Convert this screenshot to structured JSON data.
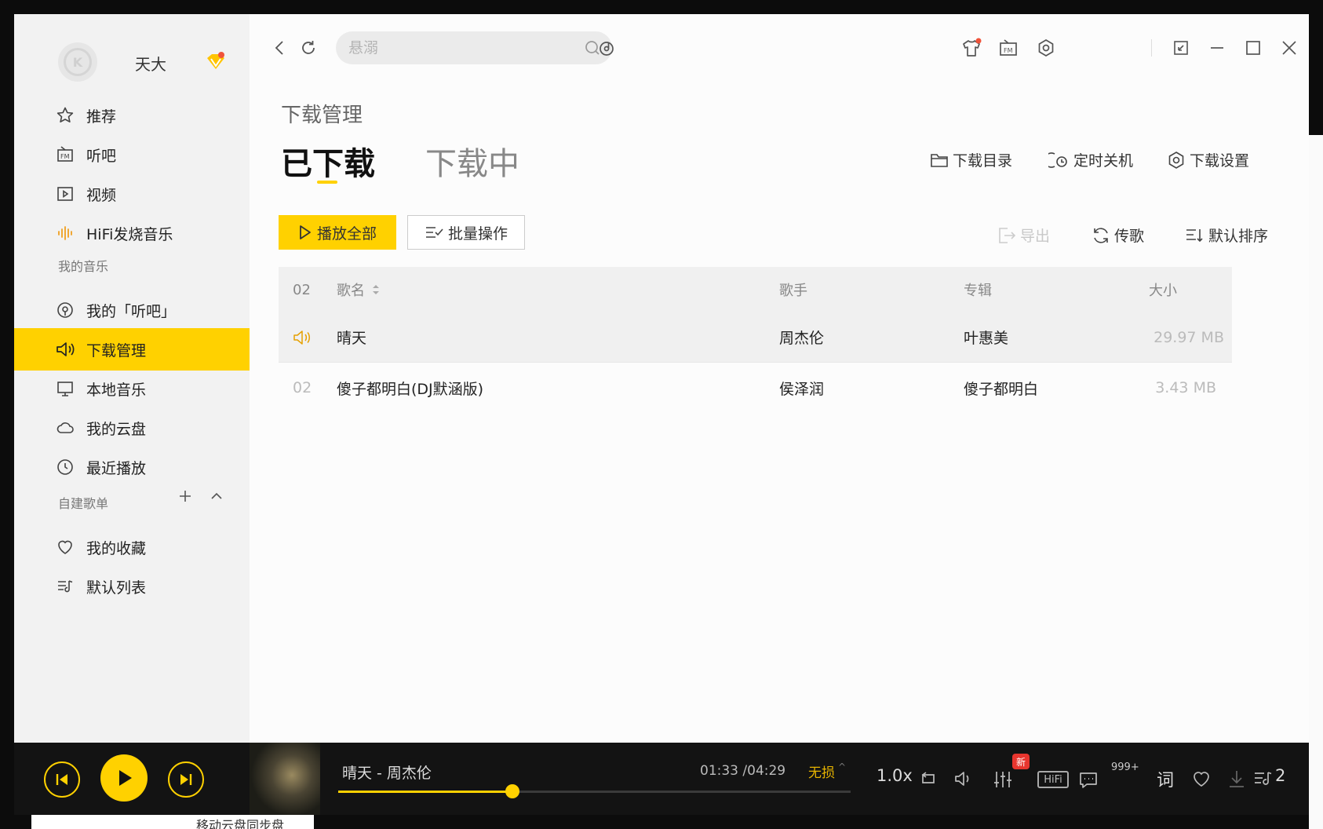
{
  "sidebar": {
    "username": "天大",
    "nav_top": [
      {
        "label": "推荐",
        "icon": "star-icon"
      },
      {
        "label": "听吧",
        "icon": "radio-icon"
      },
      {
        "label": "视频",
        "icon": "video-icon"
      },
      {
        "label": "HiFi发烧音乐",
        "icon": "hifi-wave-icon"
      }
    ],
    "my_music_title": "我的音乐",
    "nav_my": [
      {
        "label": "我的「听吧」",
        "icon": "podcast-icon"
      },
      {
        "label": "下载管理",
        "icon": "speaker-icon",
        "active": true
      },
      {
        "label": "本地音乐",
        "icon": "monitor-icon"
      },
      {
        "label": "我的云盘",
        "icon": "cloud-icon"
      },
      {
        "label": "最近播放",
        "icon": "clock-icon"
      }
    ],
    "playlist_title": "自建歌单",
    "nav_playlists": [
      {
        "label": "我的收藏",
        "icon": "heart-icon"
      },
      {
        "label": "默认列表",
        "icon": "list-music-icon"
      }
    ]
  },
  "topbar": {
    "search_placeholder": "悬溺"
  },
  "main": {
    "breadcrumb": "下载管理",
    "tab_downloaded": "已下载",
    "tab_downloading": "下载中",
    "action_dir": "下载目录",
    "action_timer": "定时关机",
    "action_settings": "下载设置",
    "btn_play_all": "播放全部",
    "btn_batch": "批量操作",
    "tool_export": "导出",
    "tool_transfer": "传歌",
    "tool_sort": "默认排序"
  },
  "table": {
    "header": {
      "num": "02",
      "name": "歌名",
      "artist": "歌手",
      "album": "专辑",
      "size": "大小"
    },
    "rows": [
      {
        "num": "",
        "name": "晴天",
        "artist": "周杰伦",
        "album": "叶惠美",
        "size": "29.97 MB",
        "playing": true
      },
      {
        "num": "02",
        "name": "傻子都明白(DJ默涵版)",
        "artist": "侯泽润",
        "album": "傻子都明白",
        "size": "3.43 MB",
        "playing": false
      }
    ]
  },
  "player": {
    "track": "晴天 - 周杰伦",
    "time": "01:33 /04:29",
    "quality": "无损",
    "progress": 0.34,
    "speed": "1.0x",
    "new_badge": "新",
    "hifi": "HiFi",
    "comment_count": "999+",
    "lyric": "词",
    "queue_count": "2"
  },
  "desktop": {
    "below_text": "移动云盘同步盘"
  },
  "colors": {
    "accent": "#ffd100",
    "player_bg": "#131313"
  }
}
